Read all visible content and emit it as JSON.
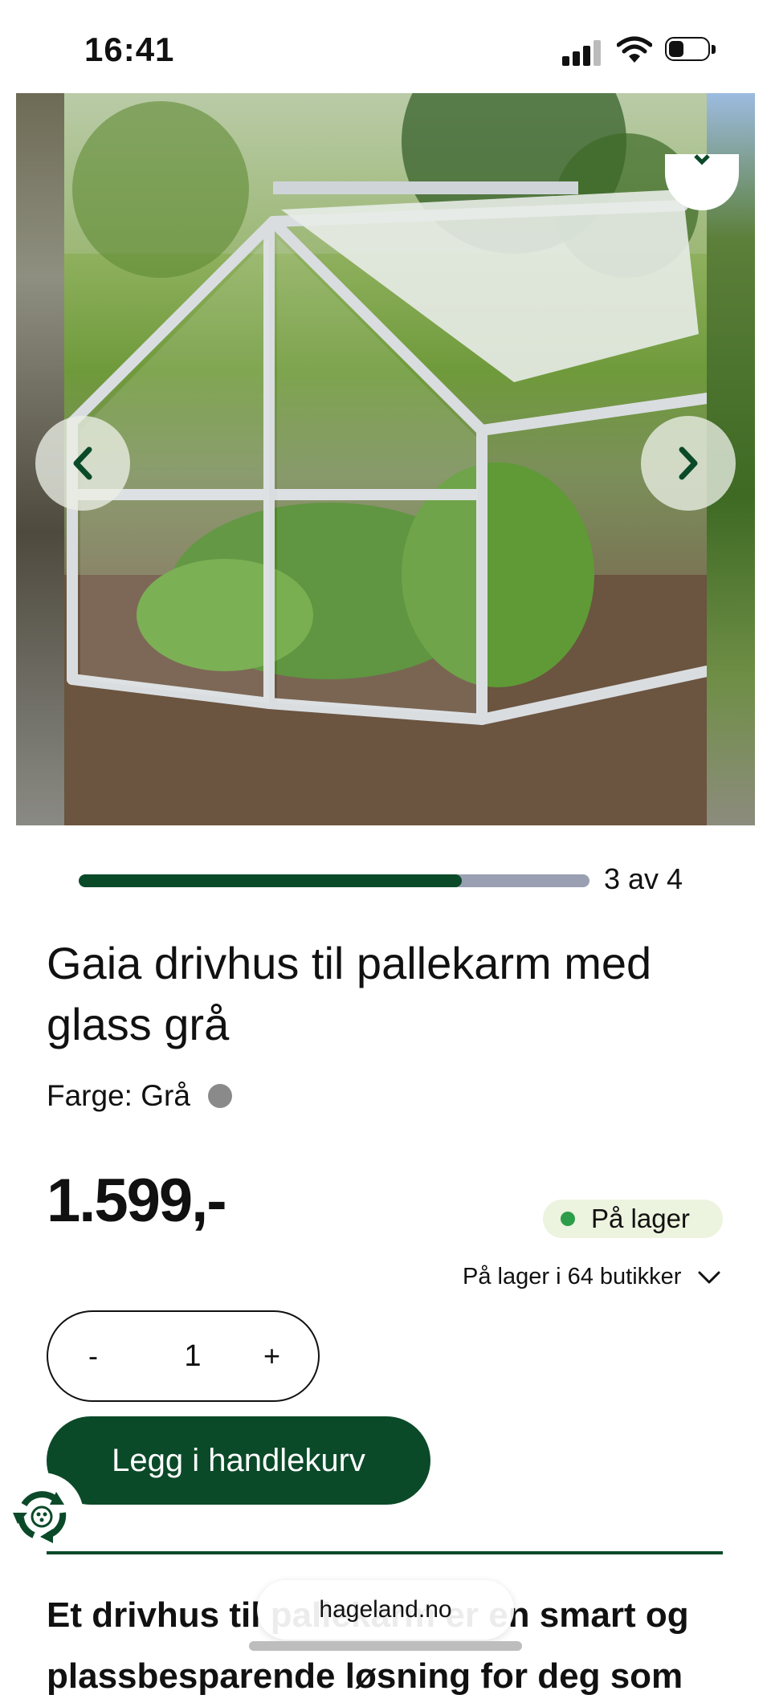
{
  "status_bar": {
    "time": "16:41",
    "battery_level": 0.3
  },
  "carousel": {
    "current": 3,
    "total": 4,
    "position_label": "3 av 4",
    "progress_fraction": 0.75,
    "prev_icon": "chevron-left-icon",
    "next_icon": "chevron-right-icon"
  },
  "product": {
    "title": "Gaia drivhus til pallekarm med glass grå",
    "color_label": "Farge: Grå",
    "color_swatch": "#8a8a8a",
    "price": "1.599,-",
    "stock_status": "På lager",
    "stock_stores": "På lager i 64 butikker",
    "quantity": "1",
    "qty_minus": "-",
    "qty_plus": "+",
    "add_to_cart": "Legg i handlekurv",
    "description_start": "Et drivhus til pallekarm er en smart og plassbesparende løsning for deg som"
  },
  "browser": {
    "url": "hageland.no"
  },
  "colors": {
    "brand_green": "#0b4a29",
    "progress_track": "#9aa0b2",
    "stock_green": "#2e9d4a",
    "stock_badge_bg": "#ecf3df"
  }
}
